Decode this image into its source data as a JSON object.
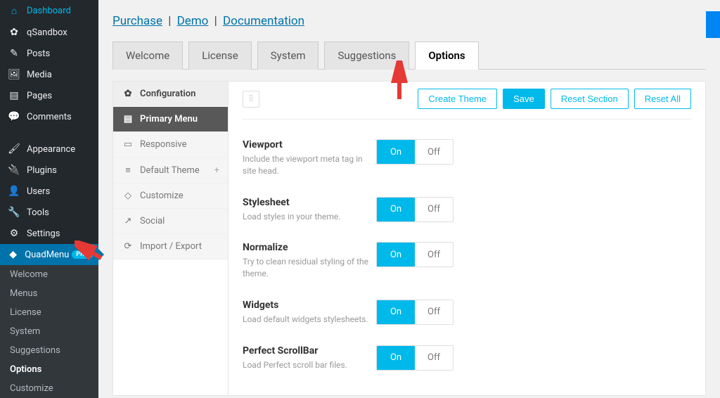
{
  "admin_menu": [
    {
      "icon": "⌂",
      "label": "Dashboard"
    },
    {
      "icon": "✿",
      "label": "qSandbox"
    },
    {
      "icon": "✎",
      "label": "Posts"
    },
    {
      "icon": "🖼",
      "label": "Media"
    },
    {
      "icon": "▤",
      "label": "Pages"
    },
    {
      "icon": "💬",
      "label": "Comments"
    },
    {
      "icon": "🖌",
      "label": "Appearance"
    },
    {
      "icon": "🔌",
      "label": "Plugins"
    },
    {
      "icon": "👤",
      "label": "Users"
    },
    {
      "icon": "🔧",
      "label": "Tools"
    },
    {
      "icon": "⚙",
      "label": "Settings"
    }
  ],
  "current_menu": {
    "icon": "◆",
    "label": "QuadMenu",
    "badge": "PRO"
  },
  "submenu": [
    "Welcome",
    "Menus",
    "License",
    "System",
    "Suggestions",
    "Options",
    "Customize"
  ],
  "submenu_active": "Options",
  "top_links": {
    "purchase": "Purchase",
    "demo": "Demo",
    "docs": "Documentation"
  },
  "tabs": [
    "Welcome",
    "License",
    "System",
    "Suggestions",
    "Options"
  ],
  "active_tab": "Options",
  "panel_nav": [
    {
      "icon": "✿",
      "label": "Configuration",
      "type": "head"
    },
    {
      "icon": "▤",
      "label": "Primary Menu",
      "type": "active"
    },
    {
      "icon": "▭",
      "label": "Responsive"
    },
    {
      "icon": "≡",
      "label": "Default Theme",
      "plus": true
    },
    {
      "icon": "◇",
      "label": "Customize"
    },
    {
      "icon": "↗",
      "label": "Social"
    },
    {
      "icon": "⟳",
      "label": "Import / Export"
    }
  ],
  "toolbar": {
    "create": "Create Theme",
    "save": "Save",
    "reset_section": "Reset Section",
    "reset_all": "Reset All"
  },
  "settings": [
    {
      "title": "Viewport",
      "desc": "Include the viewport meta tag in site head.",
      "value": "On"
    },
    {
      "title": "Stylesheet",
      "desc": "Load styles in your theme.",
      "value": "On"
    },
    {
      "title": "Normalize",
      "desc": "Try to clean residual styling of the theme.",
      "value": "On"
    },
    {
      "title": "Widgets",
      "desc": "Load default widgets stylesheets.",
      "value": "On"
    },
    {
      "title": "Perfect ScrollBar",
      "desc": "Load Perfect scroll bar files.",
      "value": "On"
    }
  ],
  "toggle_labels": {
    "on": "On",
    "off": "Off"
  }
}
